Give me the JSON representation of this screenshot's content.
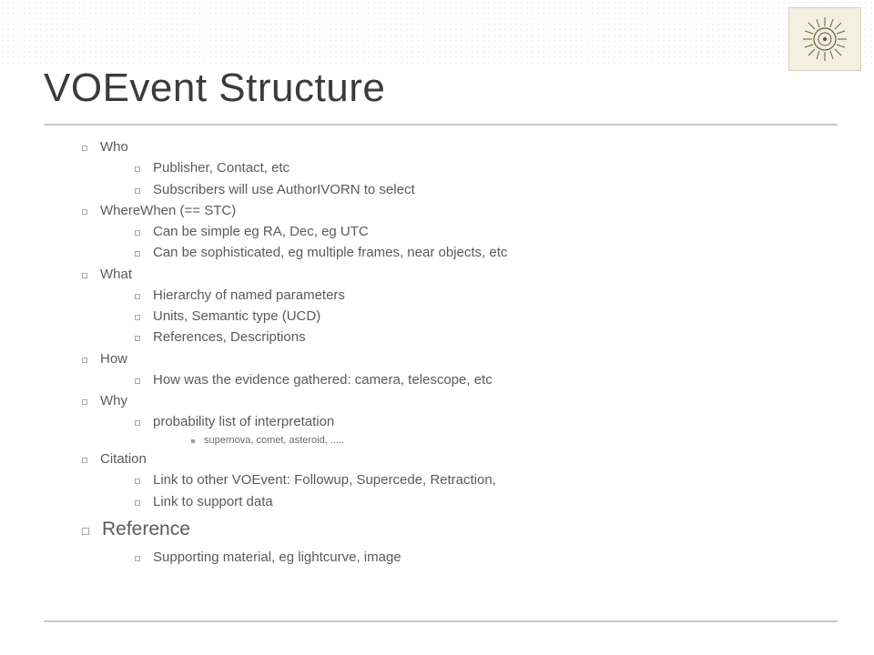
{
  "title": "VOEvent Structure",
  "sections": {
    "who": {
      "label": "Who",
      "items": [
        "Publisher, Contact, etc",
        "Subscribers will use AuthorIVORN to select"
      ]
    },
    "wherewhen": {
      "label": "WhereWhen (== STC)",
      "items": [
        "Can be simple eg RA, Dec, eg UTC",
        "Can be sophisticated, eg multiple frames, near objects, etc"
      ]
    },
    "what": {
      "label": "What",
      "items": [
        "Hierarchy of named parameters",
        "Units, Semantic type (UCD)",
        "References, Descriptions"
      ]
    },
    "how": {
      "label": "How",
      "items": [
        "How was the evidence gathered: camera, telescope, etc"
      ]
    },
    "why": {
      "label": "Why",
      "items": [
        "probability list of interpretation"
      ],
      "subitems": [
        "supernova, comet, asteroid, ....."
      ]
    },
    "citation": {
      "label": "Citation",
      "items": [
        "Link to other VOEvent: Followup, Supercede, Retraction,",
        "Link to support data"
      ]
    },
    "reference": {
      "label": "Reference",
      "items": [
        "Supporting material, eg lightcurve, image"
      ]
    }
  }
}
